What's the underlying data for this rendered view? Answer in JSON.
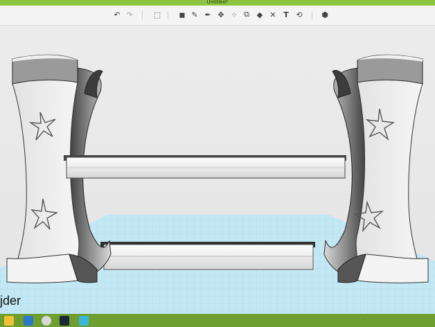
{
  "app": {
    "title": "Untitled*"
  },
  "toolbar": {
    "buttons": [
      {
        "name": "undo",
        "glyph": "↶"
      },
      {
        "name": "redo",
        "glyph": "↷"
      },
      {
        "name": "import",
        "glyph": "⬚"
      },
      {
        "name": "box",
        "glyph": "◼"
      },
      {
        "name": "sketch",
        "glyph": "✎"
      },
      {
        "name": "pen",
        "glyph": "✒"
      },
      {
        "name": "modify",
        "glyph": "✥"
      },
      {
        "name": "pattern",
        "glyph": "⁘"
      },
      {
        "name": "group",
        "glyph": "⧉"
      },
      {
        "name": "solid",
        "glyph": "◆"
      },
      {
        "name": "delete",
        "glyph": "✕"
      },
      {
        "name": "text",
        "glyph": "T"
      },
      {
        "name": "measure",
        "glyph": "⟲"
      },
      {
        "name": "material",
        "glyph": "⬢"
      }
    ]
  },
  "colors": {
    "titlebar": "#8bc53f",
    "grid": "#bfe6f2",
    "model": "#f2f2f2",
    "taskbar": "#6e9e2e"
  },
  "overlay": {
    "text": "jder"
  },
  "taskbar": {
    "icons": [
      "explorer",
      "ie",
      "chrome",
      "steam",
      "app"
    ]
  }
}
